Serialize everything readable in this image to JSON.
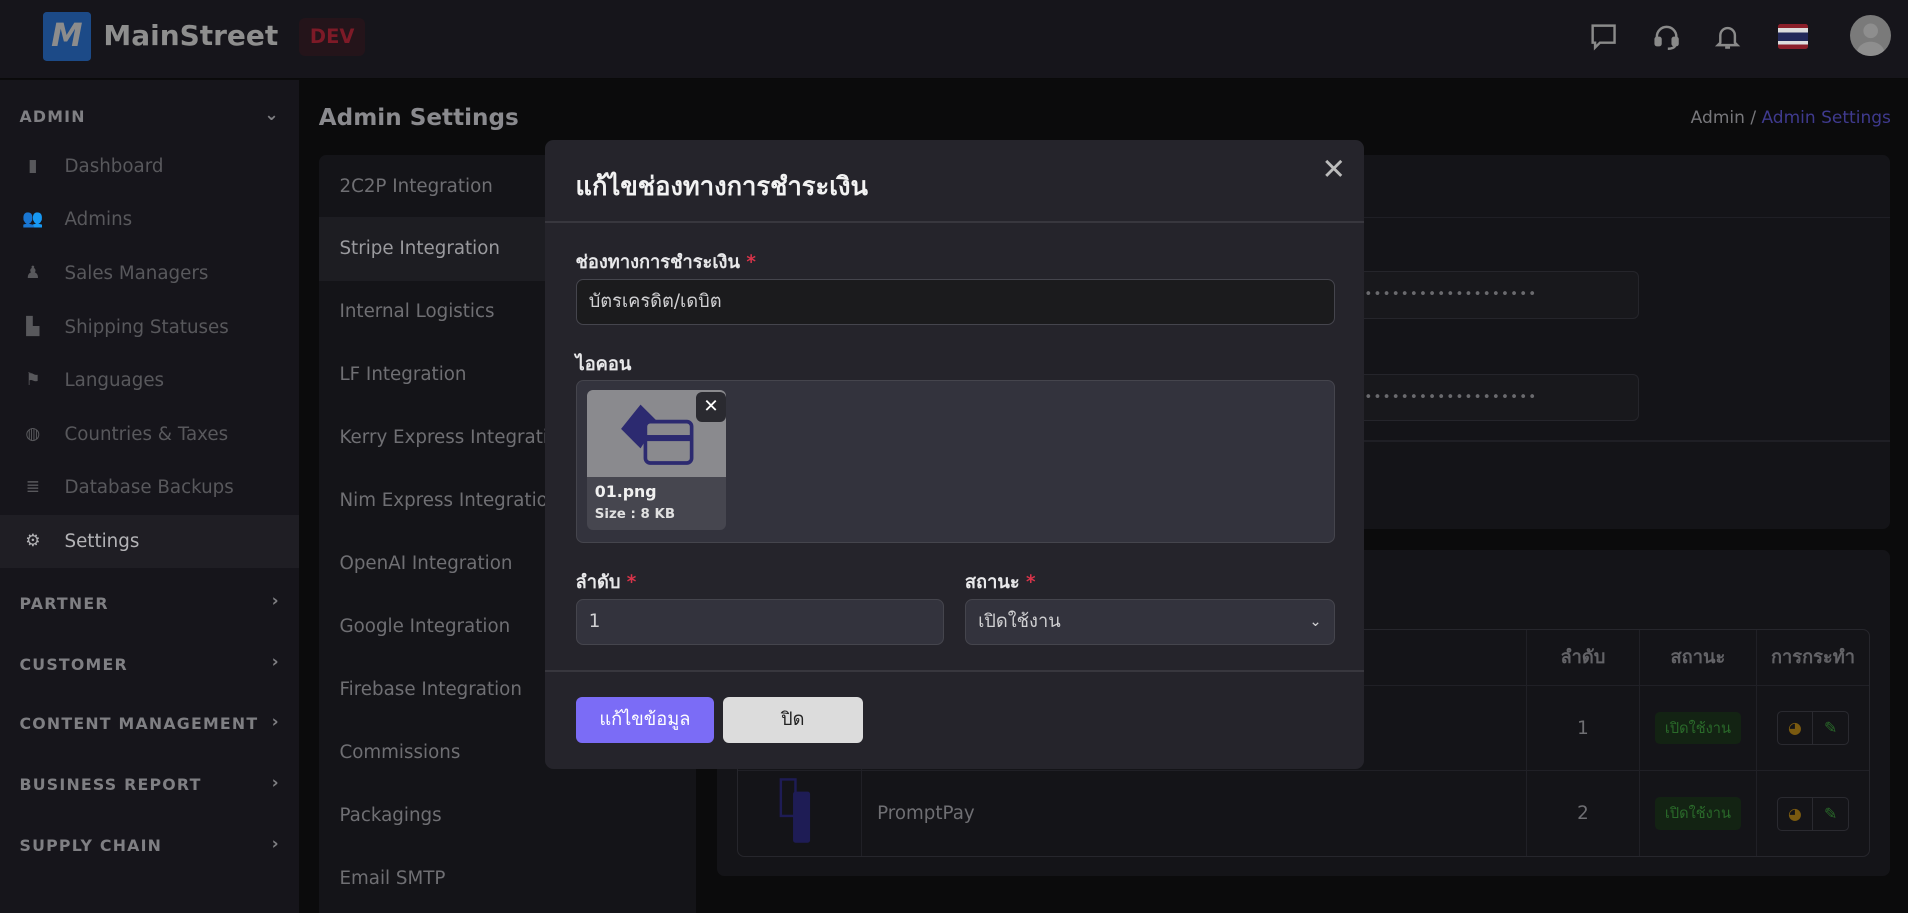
{
  "header": {
    "brand": "MainStreet",
    "logo_letter": "M",
    "env_badge": "DEV",
    "icons": [
      "chat-icon",
      "headset-icon",
      "bell-icon",
      "thai-flag-icon",
      "avatar"
    ]
  },
  "sidebar": {
    "admin_section": "ADMIN",
    "items": [
      {
        "label": "Dashboard",
        "icon": "chart-bar-icon"
      },
      {
        "label": "Admins",
        "icon": "users-icon"
      },
      {
        "label": "Sales Managers",
        "icon": "people-group-icon"
      },
      {
        "label": "Shipping Statuses",
        "icon": "dolly-icon"
      },
      {
        "label": "Languages",
        "icon": "flag-icon"
      },
      {
        "label": "Countries & Taxes",
        "icon": "globe-icon"
      },
      {
        "label": "Database Backups",
        "icon": "database-icon"
      },
      {
        "label": "Settings",
        "icon": "gear-icon",
        "active": true
      }
    ],
    "sections": [
      "PARTNER",
      "CUSTOMER",
      "CONTENT MANAGEMENT",
      "BUSINESS REPORT",
      "SUPPLY CHAIN"
    ]
  },
  "page": {
    "title": "Admin Settings",
    "breadcrumb": {
      "root": "Admin",
      "separator": " / ",
      "current": "Admin Settings"
    }
  },
  "settings_menu": [
    "2C2P Integration",
    "Stripe Integration",
    "Internal Logistics",
    "LF Integration",
    "Kerry Express Integration",
    "Nim Express Integration",
    "OpenAI Integration",
    "Google Integration",
    "Firebase Integration",
    "Commissions",
    "Packagings",
    "Email SMTP"
  ],
  "settings_active": "Stripe Integration",
  "stripe_panel": {
    "masked_value_1": "••••••••••••••••••••",
    "masked_value_2": "••••••••••••••••••••"
  },
  "payment_table": {
    "columns": [
      "",
      "",
      "ลำดับ",
      "สถานะ",
      "การกระทำ"
    ],
    "rows": [
      {
        "name": "",
        "order": "1",
        "status": "เปิดใช้งาน"
      },
      {
        "name": "PromptPay",
        "order": "2",
        "status": "เปิดใช้งาน"
      }
    ]
  },
  "modal": {
    "title": "แก้ไขช่องทางการชำระเงิน",
    "name_label": "ช่องทางการชำระเงิน",
    "name_value": "บัตรเครดิต/เดบิต",
    "icon_label": "ไอคอน",
    "file": {
      "name": "01.png",
      "size": "Size : 8 KB"
    },
    "remove_symbol": "✕",
    "order_label": "ลำดับ",
    "order_value": "1",
    "status_label": "สถานะ",
    "status_value": "เปิดใช้งาน",
    "required_mark": "*",
    "submit_label": "แก้ไขข้อมูล",
    "close_label": "ปิด"
  },
  "colors": {
    "primary": "#7b6cf6",
    "required": "#d8344a",
    "link": "#3f3a8e",
    "status_active": "#2a6a2a"
  }
}
